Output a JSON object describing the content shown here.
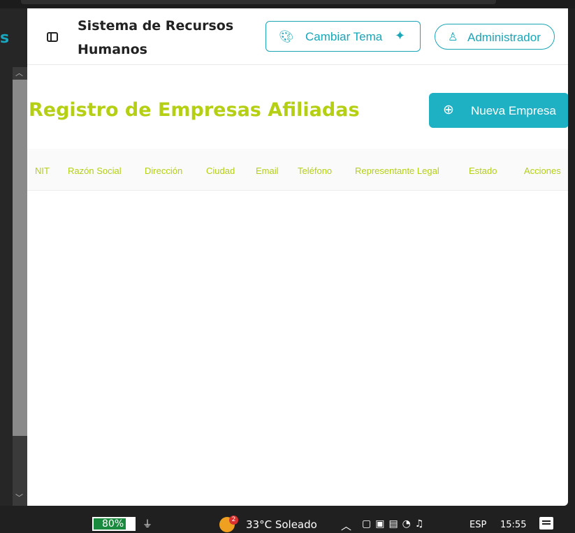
{
  "left_panel": {
    "letter": "s"
  },
  "header": {
    "title": "Sistema de Recursos Humanos",
    "theme_button": "Cambiar Tema",
    "user_button": "Administrador"
  },
  "main": {
    "title": "Registro de Empresas Afiliadas",
    "new_button": "Nueva Empresa",
    "columns": [
      "NIT",
      "Razón Social",
      "Dirección",
      "Ciudad",
      "Email",
      "Teléfono",
      "Representante Legal",
      "Estado",
      "Acciones"
    ]
  },
  "taskbar": {
    "battery": "80%",
    "weather_badge": "2",
    "weather": "33°C  Soleado",
    "language": "ESP",
    "time": "15:55"
  },
  "colors": {
    "accent": "#1aa6b7",
    "title_green": "#b5cf14"
  }
}
